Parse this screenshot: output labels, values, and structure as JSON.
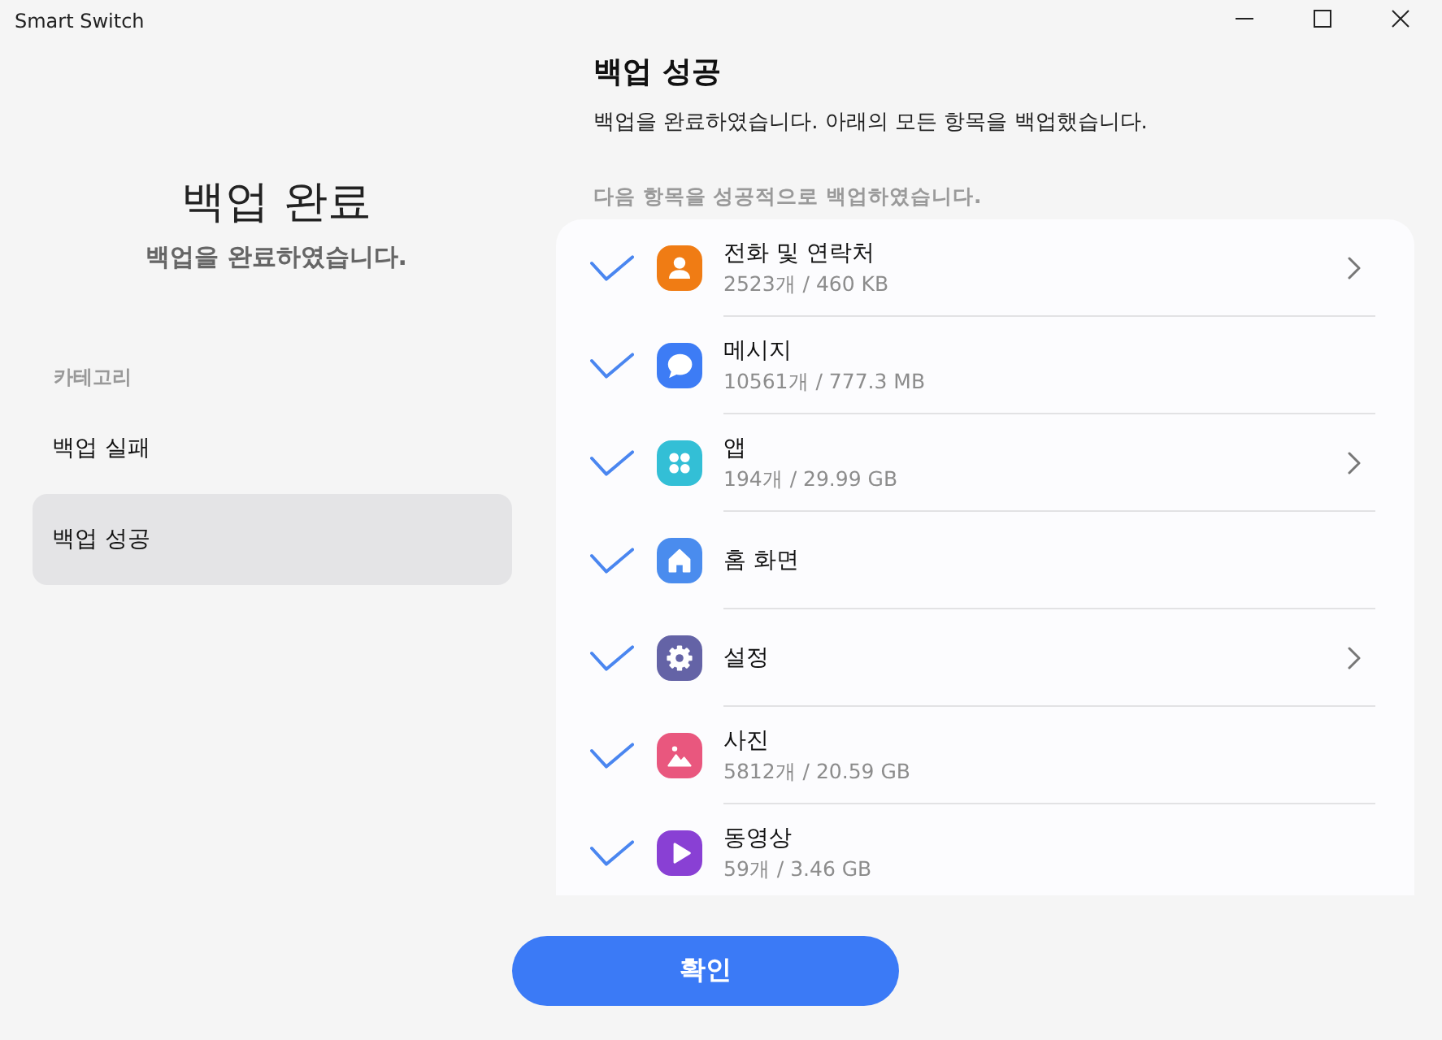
{
  "window": {
    "title": "Smart Switch"
  },
  "summary": {
    "title": "백업 완료",
    "subtitle": "백업을 완료하였습니다."
  },
  "sidebar": {
    "heading": "카테고리",
    "items": [
      {
        "label": "백업 실패",
        "selected": false
      },
      {
        "label": "백업 성공",
        "selected": true
      }
    ]
  },
  "content": {
    "title": "백업 성공",
    "description": "백업을 완료하였습니다. 아래의 모든 항목을 백업했습니다.",
    "list_heading": "다음 항목을 성공적으로 백업하였습니다.",
    "items": [
      {
        "kind": "contacts",
        "color": "#f07c14",
        "name": "전화 및 연락처",
        "detail": "2523개 / 460 KB",
        "checked": true,
        "expandable": true
      },
      {
        "kind": "messages",
        "color": "#3d7cf5",
        "name": "메시지",
        "detail": "10561개 / 777.3 MB",
        "checked": true,
        "expandable": false
      },
      {
        "kind": "apps",
        "color": "#33bfd6",
        "name": "앱",
        "detail": "194개 / 29.99 GB",
        "checked": true,
        "expandable": true
      },
      {
        "kind": "home",
        "color": "#4a8cee",
        "name": "홈 화면",
        "checked": true,
        "expandable": false
      },
      {
        "kind": "settings",
        "color": "#6463a6",
        "name": "설정",
        "checked": true,
        "expandable": true
      },
      {
        "kind": "photos",
        "color": "#e9577e",
        "name": "사진",
        "detail": "5812개 / 20.59 GB",
        "checked": true,
        "expandable": false
      },
      {
        "kind": "videos",
        "color": "#8940d4",
        "name": "동영상",
        "detail": "59개 / 3.46 GB",
        "checked": true,
        "expandable": false
      }
    ]
  },
  "buttons": [
    {
      "label": "확인"
    }
  ]
}
